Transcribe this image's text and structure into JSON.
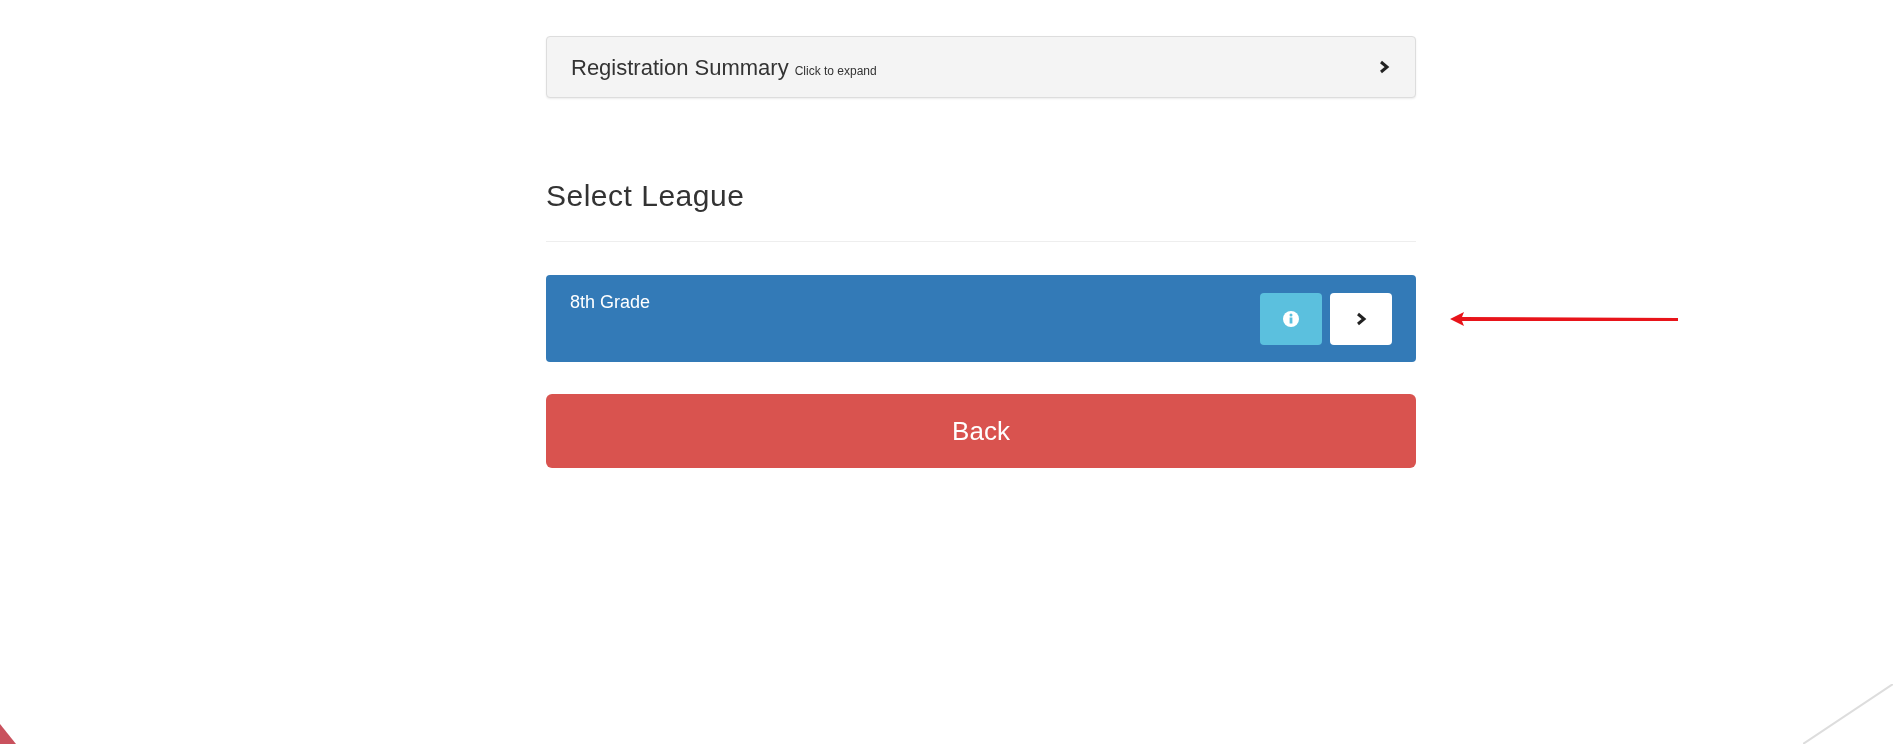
{
  "summary": {
    "title": "Registration Summary",
    "hint": "Click to expand",
    "expanded": false
  },
  "heading": "Select League",
  "leagues": [
    {
      "name": "8th Grade"
    }
  ],
  "back_button": "Back"
}
